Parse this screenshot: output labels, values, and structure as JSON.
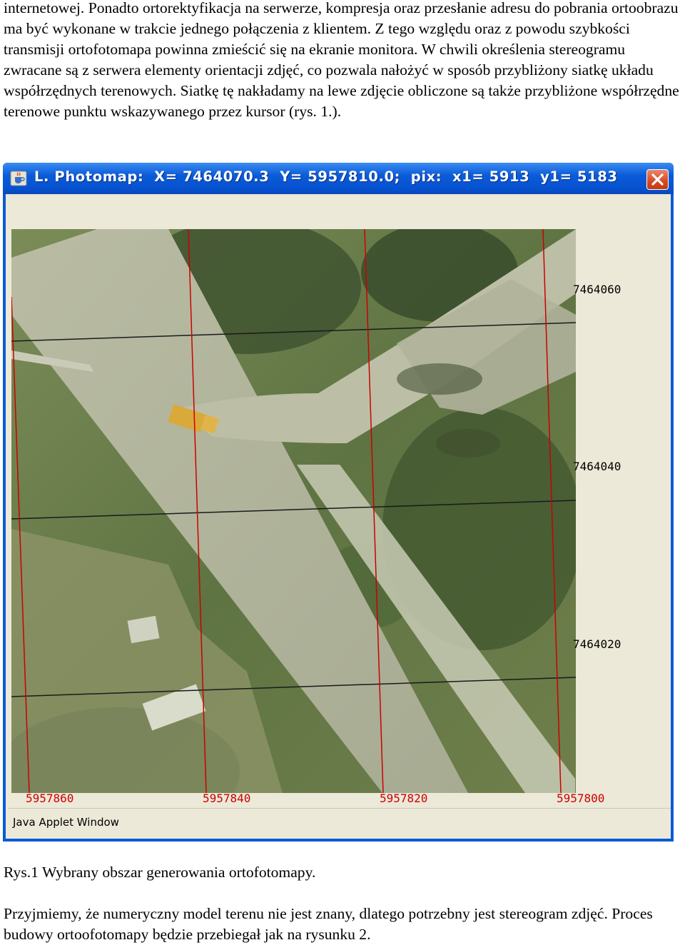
{
  "text": {
    "paragraph_top": "internetowej. Ponadto ortorektyfikacja na serwerze, kompresja oraz przesłanie adresu do pobrania ortoobrazu ma być wykonane w trakcie jednego połączenia z klientem. Z tego względu oraz z powodu szybkości transmisji ortofotomapa powinna zmieścić się na ekranie monitora. W chwili określenia stereogramu zwracane są z serwera elementy orientacji zdjęć, co pozwala nałożyć w sposób przybliżony siatkę układu współrzędnych terenowych. Siatkę tę nakładamy na lewe zdjęcie obliczone są także przybliżone współrzędne terenowe punktu wskazywanego przez kursor (rys. 1.).",
    "caption": "Rys.1 Wybrany obszar generowania ortofotomapy.",
    "paragraph_bottom": "Przyjmiemy, że numeryczny model terenu nie jest znany, dlatego potrzebny jest stereogram zdjęć. Proces budowy ortoofotomapy będzie przebiegał jak na rysunku 2."
  },
  "window": {
    "title": "L. Photomap:  X= 7464070.3  Y= 5957810.0;  pix:  x1= 5913  y1= 5183",
    "status_text": "Java Applet Window",
    "icons": {
      "app": "java-cup-icon",
      "close": "close-icon"
    },
    "colors": {
      "titlebar": "#0a5ad8",
      "close": "#d8491f",
      "client": "#ece9d8"
    }
  },
  "grid": {
    "row_labels": [
      "7464060",
      "7464040",
      "7464020"
    ],
    "column_labels": [
      "5957860",
      "5957840",
      "5957820",
      "5957800"
    ],
    "row_line_color": "#1a1a1a",
    "column_line_color": "#cc0000"
  }
}
